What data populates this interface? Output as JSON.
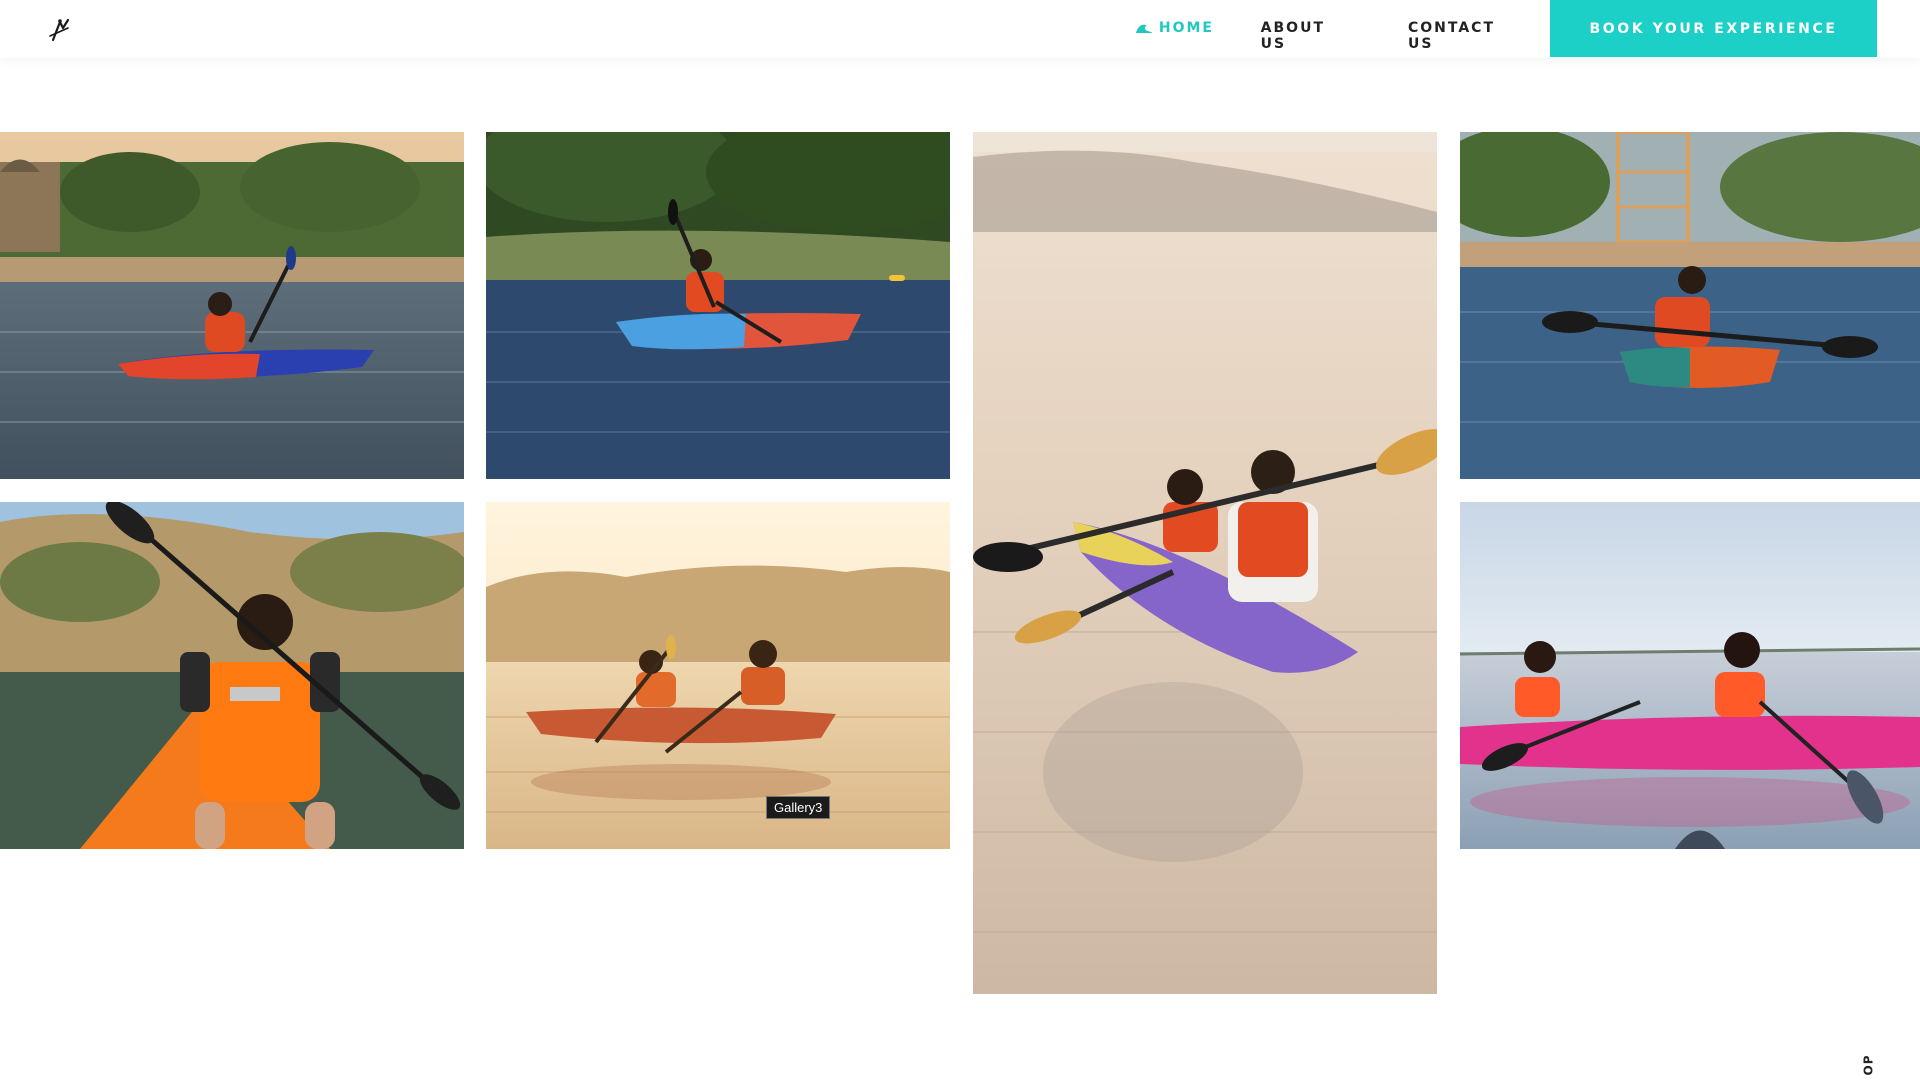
{
  "header": {
    "logo_icon": "kayak-paddler-logo-icon",
    "nav": {
      "home": {
        "label": "HOME",
        "icon": "wave-icon",
        "active": true,
        "color": "#22c7c0"
      },
      "about": {
        "label": "ABOUT US"
      },
      "contact": {
        "label": "CONTACT US"
      }
    },
    "cta": {
      "label": "BOOK YOUR EXPERIENCE",
      "color": "#1ccfc7"
    }
  },
  "gallery": {
    "tiles": [
      {
        "description_icon": "solo-kayaker-girl-photo"
      },
      {
        "description_icon": "blue-red-kayak-photo"
      },
      {
        "description_icon": "couple-tandem-kayak-photo"
      },
      {
        "description_icon": "orange-kayak-man-photo"
      },
      {
        "description_icon": "first-person-orange-kayak-photo"
      },
      {
        "description_icon": "sunset-tandem-kayak-photo"
      },
      {
        "description_icon": "pink-kayak-friends-photo"
      }
    ],
    "tooltip": "Gallery3"
  },
  "footer": {
    "scroll_top_label": "OP"
  }
}
